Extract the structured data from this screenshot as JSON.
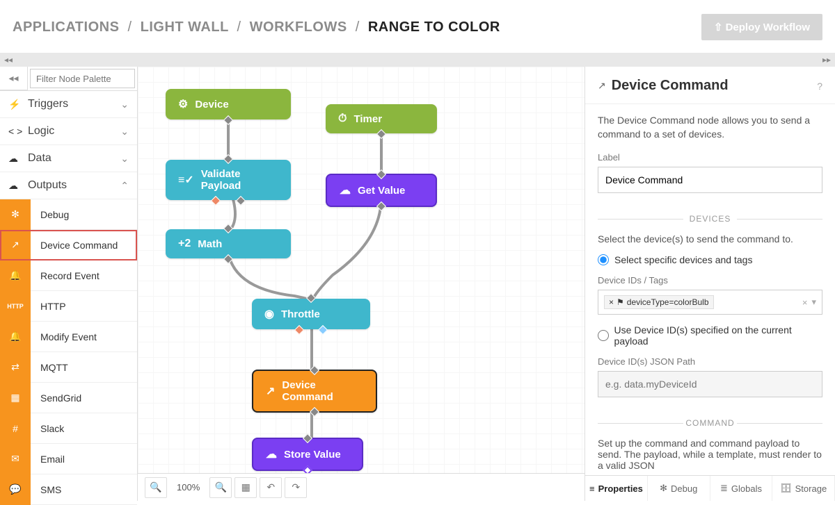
{
  "breadcrumb": {
    "app": "APPLICATIONS",
    "project": "LIGHT WALL",
    "section": "WORKFLOWS",
    "current": "RANGE TO COLOR"
  },
  "deploy_button": "Deploy Workflow",
  "filter_placeholder": "Filter Node Palette",
  "categories": {
    "triggers": "Triggers",
    "logic": "Logic",
    "data": "Data",
    "outputs": "Outputs"
  },
  "output_items": {
    "debug": "Debug",
    "device_command": "Device Command",
    "record_event": "Record Event",
    "http": "HTTP",
    "modify_event": "Modify Event",
    "mqtt": "MQTT",
    "sendgrid": "SendGrid",
    "slack": "Slack",
    "email": "Email",
    "sms": "SMS"
  },
  "nodes": {
    "device": "Device",
    "timer": "Timer",
    "validate": "Validate Payload",
    "get_value": "Get Value",
    "math_prefix": "+2",
    "math": "Math",
    "throttle": "Throttle",
    "device_command": "Device Command",
    "store_value": "Store Value"
  },
  "toolbar": {
    "zoom": "100%"
  },
  "right": {
    "title": "Device Command",
    "desc": "The Device Command node allows you to send a command to a set of devices.",
    "label_label": "Label",
    "label_value": "Device Command",
    "section_devices": "DEVICES",
    "devices_text": "Select the device(s) to send the command to.",
    "radio1": "Select specific devices and tags",
    "ids_label": "Device IDs / Tags",
    "tag_value": "deviceType=colorBulb",
    "radio2": "Use Device ID(s) specified on the current payload",
    "json_path_label": "Device ID(s) JSON Path",
    "json_path_placeholder": "e.g. data.myDeviceId",
    "section_command": "COMMAND",
    "command_text": "Set up the command and command payload to send. The payload, while a template, must render to a valid JSON"
  },
  "tabs": {
    "properties": "Properties",
    "debug": "Debug",
    "globals": "Globals",
    "storage": "Storage"
  }
}
